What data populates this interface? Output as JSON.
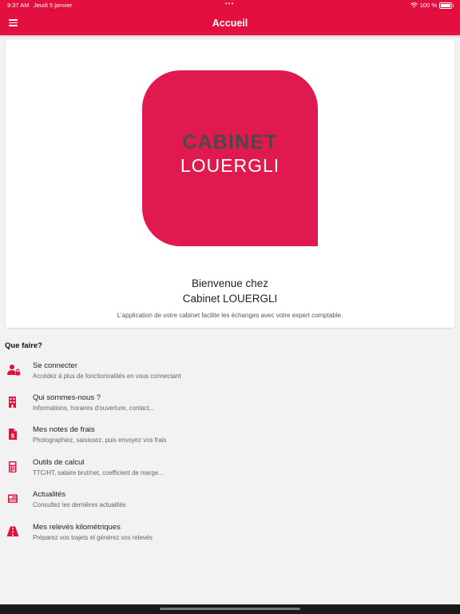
{
  "status": {
    "time": "9:37 AM",
    "date": "Jeudi 5 janvier",
    "battery": "100 %"
  },
  "navbar": {
    "title": "Accueil"
  },
  "logo": {
    "line1": "CABINET",
    "line2": "LOUERGLI"
  },
  "welcome": {
    "line1": "Bienvenue chez",
    "line2": "Cabinet LOUERGLI",
    "subtitle": "L'application de votre cabinet facilite les échanges avec votre expert comptable."
  },
  "section_title": "Que faire?",
  "items": [
    {
      "title": "Se connecter",
      "subtitle": "Accédez à plus de fonctionnalités en vous connectant",
      "icon": "user-lock-icon"
    },
    {
      "title": "Qui sommes-nous ?",
      "subtitle": "Informations, horaires d'ouverture, contact...",
      "icon": "building-icon"
    },
    {
      "title": "Mes notes de frais",
      "subtitle": "Photographiez, saisissez, puis envoyez vos frais",
      "icon": "receipt-icon"
    },
    {
      "title": "Outils de calcul",
      "subtitle": "TTC/HT, salaire brut/net, coefficient de marge...",
      "icon": "calculator-icon"
    },
    {
      "title": "Actualités",
      "subtitle": "Consultez les dernières actualités",
      "icon": "newspaper-icon"
    },
    {
      "title": "Mes relevés kilométriques",
      "subtitle": "Préparez vos trajets et générez vos relevés",
      "icon": "road-icon"
    }
  ],
  "colors": {
    "accent": "#e30f3f",
    "logo": "#e01a4f"
  }
}
